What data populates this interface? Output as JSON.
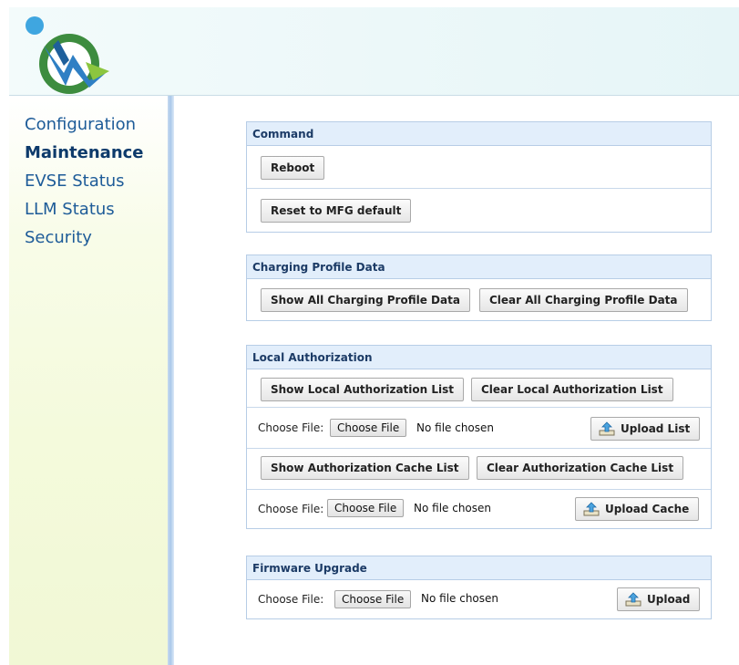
{
  "nav": {
    "items": [
      "Configuration",
      "Maintenance",
      "EVSE Status",
      "LLM Status",
      "Security"
    ],
    "active": "Maintenance"
  },
  "command": {
    "title": "Command",
    "reboot": "Reboot",
    "reset": "Reset to MFG default"
  },
  "charging_profile": {
    "title": "Charging Profile Data",
    "show_all": "Show All Charging Profile Data",
    "clear_all": "Clear All Charging Profile Data"
  },
  "local_auth": {
    "title": "Local Authorization",
    "show_list": "Show Local Authorization List",
    "clear_list": "Clear Local Authorization List",
    "file_label": "Choose File:",
    "choose_file": "Choose File",
    "file_status": "No file chosen",
    "upload_list": "Upload List",
    "show_cache": "Show Authorization Cache List",
    "clear_cache": "Clear Authorization Cache List",
    "cache_file_label": "Choose File:",
    "cache_choose_file": "Choose File",
    "cache_file_status": "No file chosen",
    "upload_cache": "Upload Cache"
  },
  "firmware": {
    "title": "Firmware Upgrade",
    "file_label": "Choose File:",
    "choose_file": "Choose File",
    "file_status": "No file chosen",
    "upload": "Upload"
  },
  "colors": {
    "nav_link": "#1d5b98",
    "panel_header_bg": "#e2eefb",
    "panel_border": "#b7cde6"
  },
  "icons": [
    "logo-icon",
    "upload-icon"
  ]
}
